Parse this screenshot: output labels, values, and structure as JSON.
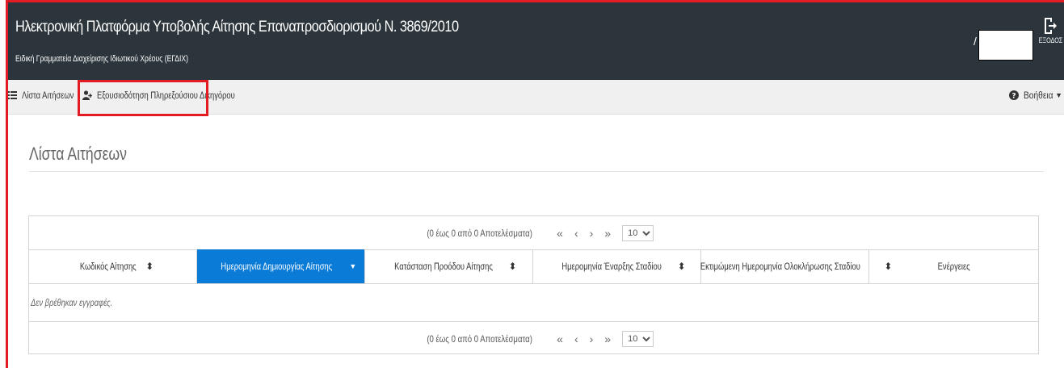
{
  "header": {
    "title": "Ηλεκτρονική Πλατφόρμα Υποβολής Αίτησης Επαναπροσδιορισμού Ν. 3869/2010",
    "subtitle": "Ειδική Γραμματεία Διαχείρισης Ιδιωτικού Χρέους (ΕΓΔΙΧ)",
    "user_separator": "/",
    "exit_label": "ΕΞΟΔΟΣ",
    "exit_icon": "sign-out-icon"
  },
  "nav": {
    "list_label": "Λίστα Αιτήσεων",
    "list_icon": "list-icon",
    "authorize_label": "Εξουσιοδότηση Πληρεξούσιου Δικηγόρου",
    "authorize_icon": "user-plus-icon",
    "help_label": "Βοήθεια",
    "help_icon": "question-circle-icon"
  },
  "page": {
    "title": "Λίστα Αιτήσεων"
  },
  "grid": {
    "pager_info": "(0 έως 0 από 0 Αποτελέσματα)",
    "page_size": "10",
    "page_size_options": [
      "10"
    ],
    "columns": [
      {
        "label": "Κωδικός Αίτησης",
        "sort": "both",
        "active": false
      },
      {
        "label": "Ημερομηνία Δημιουργίας Αίτησης",
        "sort": "desc",
        "active": true
      },
      {
        "label": "Κατάσταση Προόδου Αίτησης",
        "sort": "both",
        "active": false
      },
      {
        "label": "Ημερομηνία Έναρξης Σταδίου",
        "sort": "both",
        "active": false
      },
      {
        "label": "Εκτιμώμενη Ημερομηνία Ολοκλήρωσης Σταδίου",
        "sort": "both",
        "active": false
      },
      {
        "label": "Ενέργειες",
        "sort": "none",
        "active": false
      }
    ],
    "empty_message": "Δεν βρέθηκαν εγγραφές."
  },
  "colors": {
    "header_bg": "#2b353b",
    "active_column": "#0a7bd6",
    "highlight": "#e31b23"
  }
}
